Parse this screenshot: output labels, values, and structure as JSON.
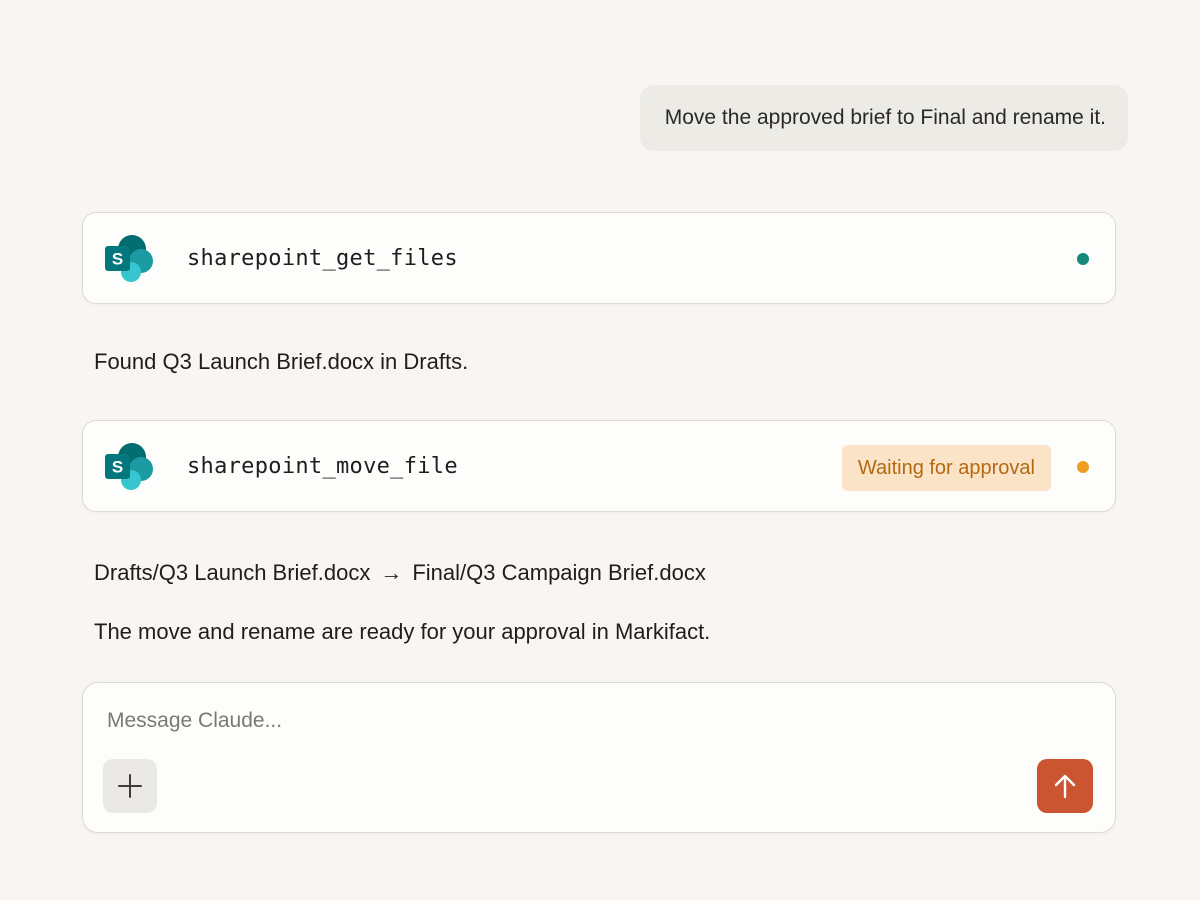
{
  "user_message": "Move the approved brief to Final and rename it.",
  "tool_calls": [
    {
      "name": "sharepoint_get_files",
      "icon": "sharepoint-icon",
      "status": "completed",
      "status_color": "#14897a"
    },
    {
      "name": "sharepoint_move_file",
      "icon": "sharepoint-icon",
      "status": "pending",
      "badge": "Waiting for approval",
      "status_color": "#ef9d20"
    }
  ],
  "assistant": {
    "found_text": "Found Q3 Launch Brief.docx in Drafts.",
    "move_source": "Drafts/Q3 Launch Brief.docx",
    "move_arrow": "→",
    "move_target": "Final/Q3 Campaign Brief.docx",
    "ready_text": "The move and rename are ready for your approval in Markifact."
  },
  "composer": {
    "placeholder": "Message Claude...",
    "value": "",
    "add_icon": "plus-icon",
    "send_icon": "arrow-up-icon"
  },
  "colors": {
    "background": "#f8f5f2",
    "accent": "#cb5530",
    "sharepoint": "#0a7f7a",
    "badge_bg": "#fae3c7",
    "badge_text": "#b26a12"
  }
}
